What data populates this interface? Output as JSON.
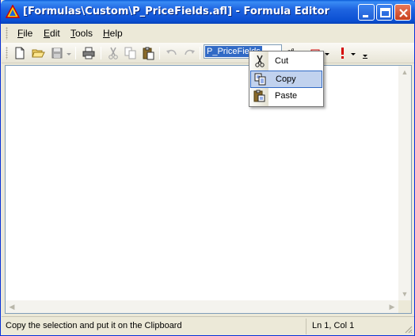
{
  "window": {
    "title": "[Formulas\\Custom\\P_PriceFields.afl] - Formula Editor",
    "title_bar_colors": {
      "active": "#0a5bd8",
      "close": "#e8785a"
    }
  },
  "menubar": {
    "items": [
      {
        "label": "File",
        "accel": "F",
        "rest": "ile"
      },
      {
        "label": "Edit",
        "accel": "E",
        "rest": "dit"
      },
      {
        "label": "Tools",
        "accel": "T",
        "rest": "ools"
      },
      {
        "label": "Help",
        "accel": "H",
        "rest": "elp"
      }
    ]
  },
  "toolbar": {
    "formula_name_combo": "P_PriceFields",
    "icons": [
      "new-file-icon",
      "open-folder-icon",
      "save-icon",
      "print-icon",
      "cut-icon",
      "copy-icon",
      "paste-icon",
      "undo-icon",
      "redo-icon",
      "insert-afl-icon",
      "verify-syntax-icon",
      "apply-indicator-icon"
    ]
  },
  "context_menu": {
    "items": [
      {
        "label": "Cut",
        "icon": "scissors-icon",
        "highlighted": false
      },
      {
        "label": "Copy",
        "icon": "copy-icon",
        "highlighted": true
      },
      {
        "label": "Paste",
        "icon": "clipboard-icon",
        "highlighted": false
      }
    ],
    "highlight_color": "#c1d2ee"
  },
  "statusbar": {
    "message": "Copy the selection and put it on the Clipboard",
    "position": "Ln 1, Col 1"
  }
}
